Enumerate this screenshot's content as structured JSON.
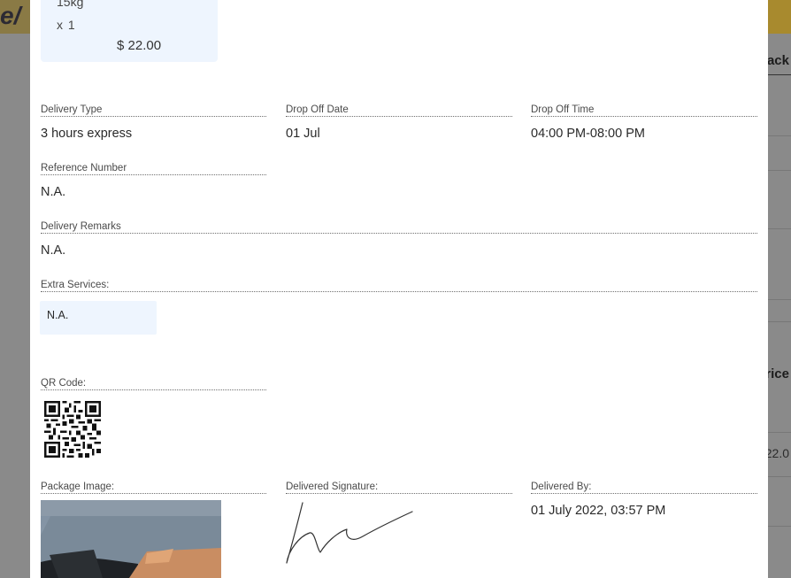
{
  "background": {
    "logo_glyph": "e/",
    "right_texts": [
      "ack",
      "rice",
      "22.0"
    ]
  },
  "item": {
    "weight": "15kg",
    "quantity": "x 1",
    "price": "$ 22.00"
  },
  "delivery_type": {
    "label": "Delivery Type",
    "value": "3 hours express"
  },
  "drop_off_date": {
    "label": "Drop Off Date",
    "value": "01 Jul"
  },
  "drop_off_time": {
    "label": "Drop Off Time",
    "value": "04:00 PM-08:00 PM"
  },
  "reference_number": {
    "label": "Reference Number",
    "value": "N.A."
  },
  "delivery_remarks": {
    "label": "Delivery Remarks",
    "value": "N.A."
  },
  "extra_services": {
    "label": "Extra Services:",
    "value": "N.A."
  },
  "qr_code": {
    "label": "QR Code:"
  },
  "package_image": {
    "label": "Package Image:"
  },
  "delivered_signature": {
    "label": "Delivered Signature:"
  },
  "delivered_by": {
    "label": "Delivered By:",
    "value": "01 July 2022, 03:57 PM"
  },
  "colors": {
    "overlay": "#8a8a8a",
    "topbar": "#8a7a45",
    "card_bg": "#eef5fe"
  }
}
